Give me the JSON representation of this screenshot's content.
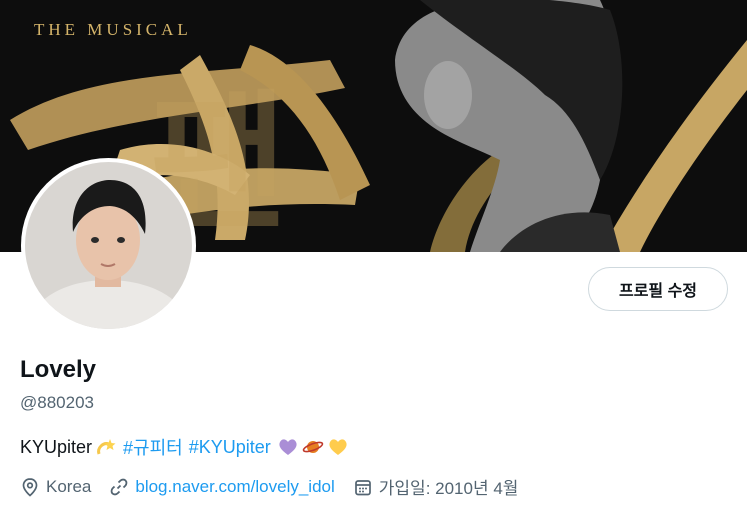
{
  "banner": {
    "tagline": "THE MUSICAL",
    "title_glyph": "팬"
  },
  "profile": {
    "edit_button_label": "프로필 수정",
    "name": "Lovely",
    "handle": "@880203",
    "bio": {
      "text": "KYUpiter",
      "hashtags": [
        "#규피터",
        "#KYUpiter"
      ],
      "emoji_names": [
        "dizzy-emoji",
        "purple-heart-emoji",
        "ringed-planet-emoji",
        "yellow-heart-emoji"
      ]
    },
    "location": "Korea",
    "website": "blog.naver.com/lovely_idol",
    "joined": "가입일: 2010년 4월"
  },
  "colors": {
    "accent": "#1d9bf0",
    "text_primary": "#0f1419",
    "text_secondary": "#536471",
    "gold": "#c9a75a"
  }
}
